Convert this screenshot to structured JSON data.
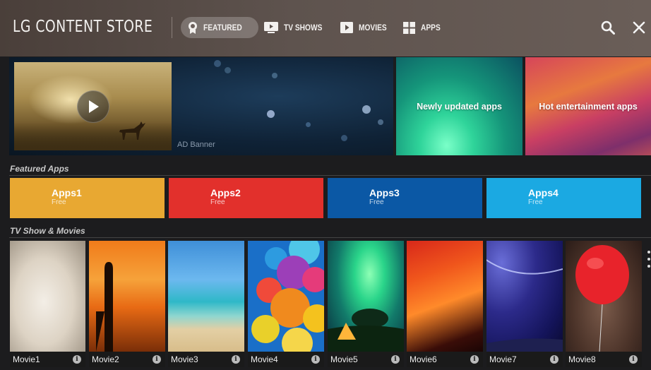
{
  "header": {
    "brand": "LG CONTENT STORE",
    "tabs": [
      {
        "label": "FEATURED",
        "icon": "featured-badge-icon",
        "active": true
      },
      {
        "label": "TV SHOWS",
        "icon": "tv-play-icon",
        "active": false
      },
      {
        "label": "MOVIES",
        "icon": "film-play-icon",
        "active": false
      },
      {
        "label": "APPS",
        "icon": "apps-grid-icon",
        "active": false
      }
    ],
    "search_icon": "search-icon",
    "close_icon": "close-icon"
  },
  "hero": {
    "ad_label": "AD Banner",
    "play_icon": "play-icon",
    "promos": [
      {
        "label": "Newly updated apps"
      },
      {
        "label": "Hot entertainment apps"
      }
    ]
  },
  "featured_apps": {
    "title": "Featured Apps",
    "items": [
      {
        "name": "Apps1",
        "price": "Free",
        "color": "#e8a832"
      },
      {
        "name": "Apps2",
        "price": "Free",
        "color": "#e2302c"
      },
      {
        "name": "Apps3",
        "price": "Free",
        "color": "#0b58a5"
      },
      {
        "name": "Apps4",
        "price": "Free",
        "color": "#1ba9e2"
      }
    ]
  },
  "movies": {
    "title": "TV Show & Movies",
    "items": [
      {
        "title": "Movie1"
      },
      {
        "title": "Movie2"
      },
      {
        "title": "Movie3"
      },
      {
        "title": "Movie4"
      },
      {
        "title": "Movie5"
      },
      {
        "title": "Movie6"
      },
      {
        "title": "Movie7"
      },
      {
        "title": "Movie8"
      }
    ],
    "info_icon": "info-icon",
    "info_glyph": "i"
  }
}
